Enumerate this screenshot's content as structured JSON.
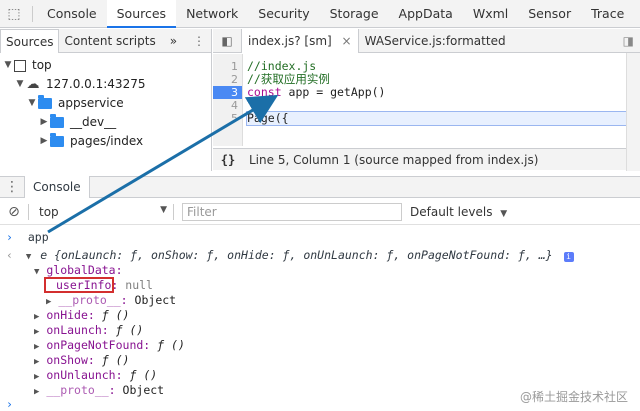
{
  "main_tabs": [
    "Console",
    "Sources",
    "Network",
    "Security",
    "Storage",
    "AppData",
    "Wxml",
    "Sensor",
    "Trace"
  ],
  "active_main_tab": "Sources",
  "navigator": {
    "tabs": [
      "Sources",
      "Content scripts"
    ],
    "more": "»",
    "tree": [
      {
        "label": "top",
        "indent": 0,
        "icon": "frame-icon"
      },
      {
        "label": "127.0.0.1:43275",
        "indent": 1,
        "icon": "cloud-icon"
      },
      {
        "label": "appservice",
        "indent": 2,
        "icon": "folder-icon"
      },
      {
        "label": "__dev__",
        "indent": 3,
        "icon": "folder-icon"
      },
      {
        "label": "pages/index",
        "indent": 3,
        "icon": "folder-icon"
      }
    ]
  },
  "editor": {
    "tabs": [
      {
        "label": "index.js? [sm]"
      },
      {
        "label": "WAService.js:formatted"
      }
    ],
    "lines": [
      {
        "num": "1",
        "text": "//index.js",
        "type": "comment"
      },
      {
        "num": "2",
        "text": "//获取应用实例",
        "type": "comment"
      },
      {
        "num": "3",
        "pre": "const",
        "text": " app = getApp()",
        "type": "code",
        "breakpoint": true
      },
      {
        "num": "4",
        "text": "",
        "type": "code"
      },
      {
        "num": "5",
        "text": "Page({",
        "type": "code"
      }
    ],
    "status": "Line 5, Column 1   (source mapped from index.js)",
    "status_icon": "{}"
  },
  "drawer": {
    "tab": "Console",
    "context": "top",
    "filter_placeholder": "Filter",
    "levels": "Default levels"
  },
  "console": {
    "input": "app",
    "object_summary": "e {onLaunch: ƒ, onShow: ƒ, onHide: ƒ, onUnLaunch: ƒ, onPageNotFound: ƒ, …}",
    "rows": [
      {
        "key": "globalData",
        "value": "",
        "indent": 1,
        "expanded": true
      },
      {
        "key": "userInfo",
        "value": "null",
        "indent": 2,
        "expanded": null
      },
      {
        "key": "__proto__",
        "value": "Object",
        "indent": 2,
        "expanded": false
      },
      {
        "key": "onHide",
        "value": "ƒ ()",
        "indent": 1,
        "expanded": false
      },
      {
        "key": "onLaunch",
        "value": "ƒ ()",
        "indent": 1,
        "expanded": false
      },
      {
        "key": "onPageNotFound",
        "value": "ƒ ()",
        "indent": 1,
        "expanded": false
      },
      {
        "key": "onShow",
        "value": "ƒ ()",
        "indent": 1,
        "expanded": false
      },
      {
        "key": "onUnlaunch",
        "value": "ƒ ()",
        "indent": 1,
        "expanded": false
      },
      {
        "key": "__proto__",
        "value": "Object",
        "indent": 1,
        "expanded": false
      }
    ]
  },
  "watermark": "@稀土掘金技术社区",
  "colors": {
    "accent": "#1a73e8",
    "breakpoint": "#4a89f3",
    "arrow": "#1b6fa8",
    "highlight": "#d32f2f"
  }
}
